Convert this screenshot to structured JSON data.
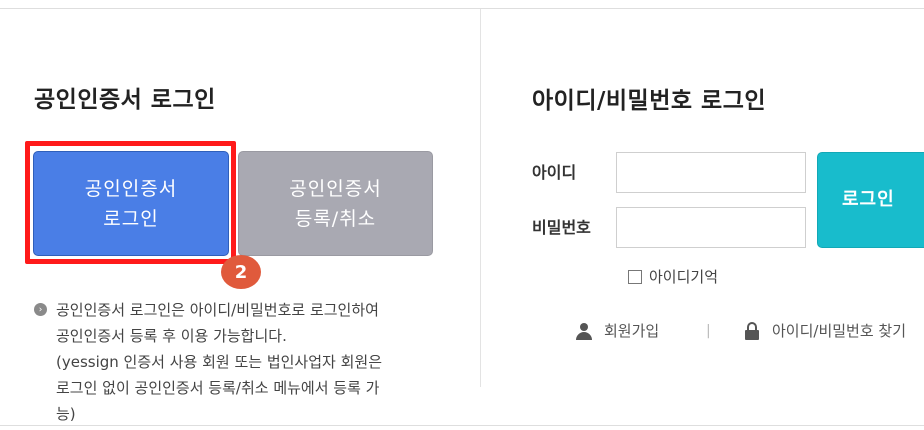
{
  "cert_section": {
    "title": "공인인증서 로그인",
    "login_button": {
      "line1": "공인인증서",
      "line2": "로그인"
    },
    "register_button": {
      "line1": "공인인증서",
      "line2": "등록/취소"
    },
    "step_badge": "2",
    "notice_lines": [
      "공인인증서 로그인은 아이디/비밀번호로 로그인하여",
      "공인인증서 등록 후 이용 가능합니다.",
      "(yessign 인증서 사용 회원 또는 법인사업자 회원은",
      "로그인 없이 공인인증서 등록/취소 메뉴에서 등록 가",
      "능)"
    ]
  },
  "id_section": {
    "title": "아이디/비밀번호 로그인",
    "id_label": "아이디",
    "id_value": "",
    "password_label": "비밀번호",
    "password_value": "",
    "login_button": "로그인",
    "remember_label": "아이디기억",
    "remember_checked": false,
    "signup_link": "회원가입",
    "separator": "|",
    "find_link": "아이디/비밀번호 찾기"
  },
  "colors": {
    "highlight": "#ff1a1a",
    "cert_login_bg": "#4a7ee6",
    "cert_register_bg": "#a9a9b2",
    "login_bg": "#18bccc",
    "badge_bg": "#e05a3c"
  }
}
